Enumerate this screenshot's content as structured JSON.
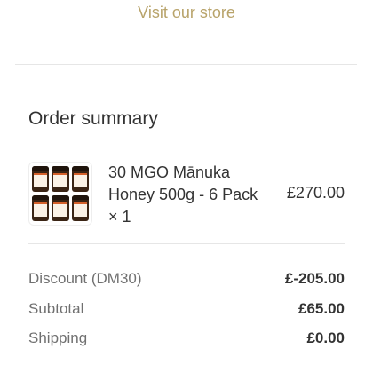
{
  "header": {
    "visit_store_label": "Visit our store"
  },
  "order_summary": {
    "title": "Order summary",
    "item": {
      "thumbnail_icon": "honey-jar-6-pack-image",
      "name": "30 MGO Mānuka Honey 500g - 6 Pack × 1",
      "price": "£270.00"
    },
    "lines": {
      "discount": {
        "label": "Discount (DM30)",
        "value": "£-205.00"
      },
      "subtotal": {
        "label": "Subtotal",
        "value": "£65.00"
      },
      "shipping": {
        "label": "Shipping",
        "value": "£0.00"
      }
    }
  },
  "colors": {
    "link": "#b8a36a",
    "text": "#333333",
    "muted": "#707070",
    "divider": "#e6e6e6"
  }
}
